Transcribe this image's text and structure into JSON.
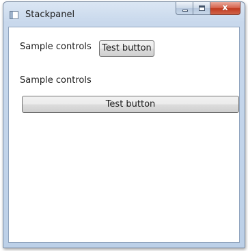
{
  "window": {
    "title": "Stackpanel"
  },
  "content": {
    "horizontal_label": "Sample controls",
    "horizontal_button": "Test button",
    "vertical_label": "Sample controls",
    "vertical_button": "Test button"
  },
  "caption_buttons": {
    "close_glyph": "x"
  },
  "icons": {
    "app": "window-app-icon",
    "minimize": "minimize-icon",
    "maximize": "maximize-icon",
    "close": "close-icon"
  },
  "colors": {
    "chrome": "#c8d8ec",
    "close_button": "#d0503a",
    "client_background": "#ffffff"
  }
}
